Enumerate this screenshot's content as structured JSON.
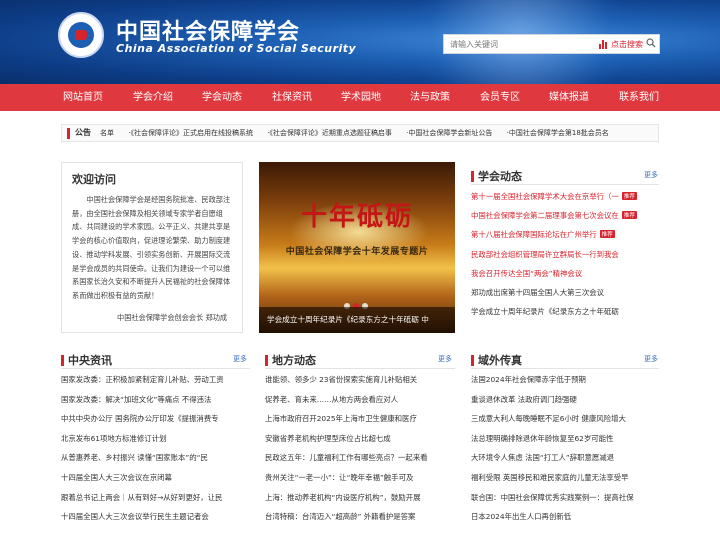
{
  "header": {
    "title": "中国社会保障学会",
    "subtitle": "China Association of Social Security",
    "search": {
      "placeholder": "请输入关键词",
      "button_label": "点击搜索"
    }
  },
  "nav": [
    "网站首页",
    "学会介绍",
    "学会动态",
    "社保资讯",
    "学术园地",
    "法与政策",
    "会员专区",
    "媒体报道",
    "联系我们"
  ],
  "notice": {
    "label": "公告",
    "items": [
      "名单",
      "·《社会保障评论》正式启用在线投稿系统",
      "·《社会保障评论》近期重点选题征稿启事",
      "·中国社会保障学会新址公告",
      "·中国社会保障学会第18批会员名"
    ]
  },
  "welcome": {
    "title": "欢迎访问",
    "body": "中国社会保障学会是经国务院批准、民政部注册，由全国社会保障及相关领域专家学者自愿组成、共同建设的学术家园。公平正义、共建共享是学会的核心价值取向，促进理论繁荣、助力制度建设、推动学科发展、引领实务创新、开展国际交流是学会成员的共同使命。让我们为建设一个可以维系国家长治久安和不断提升人民福祉的社会保障体系而做出积极有益的贡献！",
    "signature": "中国社会保障学会创会会长 郑功成"
  },
  "hero": {
    "calligraphy": "十年砥砺",
    "subline": "中国社会保障学会十年发展专题片",
    "caption": "学会成立十周年纪录片《纪录东方之十年砥砺 中"
  },
  "news": {
    "title": "学会动态",
    "more": "更多",
    "items": [
      {
        "text": "第十一届全国社会保障学术大会在京举行（一",
        "tag": "推荐",
        "style": "red"
      },
      {
        "text": "中国社会保障学会第二届理事会第七次会议在",
        "tag": "推荐",
        "style": "red"
      },
      {
        "text": "第十八届社会保障国际论坛在广州举行",
        "tag": "推荐",
        "style": "red"
      },
      {
        "text": "民政部社会组织管理局许立群局长一行到我会",
        "tag": "",
        "style": "red"
      },
      {
        "text": "我会召开传达全国“两会”精神会议",
        "tag": "",
        "style": "red"
      },
      {
        "text": "郑功成出席第十四届全国人大第三次会议",
        "tag": "",
        "style": "dark"
      },
      {
        "text": "学会成立十周年纪录片《纪录东方之十年砥砺",
        "tag": "",
        "style": "dark"
      }
    ]
  },
  "central": {
    "title": "中央资讯",
    "more": "更多",
    "items": [
      "国家发改委：正积极加紧制定育儿补贴、劳动工资",
      "国家发改委：解决“加班文化”等痛点 不得违法",
      "中共中央办公厅 国务院办公厅印发《提振消费专",
      "北京发布61项地方标准修订计划",
      "从普惠养老、乡村振兴 读懂“国家账本”的“民",
      "十四届全国人大三次会议在京闭幕",
      "跟着总书记上两会｜从有到好→从好到更好，让民",
      "十四届全国人大三次会议举行民生主题记者会"
    ]
  },
  "local": {
    "title": "地方动态",
    "more": "更多",
    "items": [
      "谁能领、领多少 23省份探索实施育儿补贴相关",
      "促养老、育未来……从地方两会看应对人",
      "上海市政府召开2025年上海市卫生健康和医疗",
      "安徽省养老机构护理型床位占比超七成",
      "民政这五年：儿童福利工作有哪些亮点？一起来看",
      "贵州关注“一老一小”：让“晚年幸福”触手可及",
      "上海：推动养老机构“内设医疗机构”，鼓励开展",
      "台湾特稿：台湾迈入“超高龄” 外籍看护是答案"
    ]
  },
  "overseas": {
    "title": "域外传真",
    "more": "更多",
    "items": [
      "法国2024年社会保障赤字低于预期",
      "重谈退休改革 法政府调门趋强硬",
      "三成意大利人每晚睡眠不足6小时 健康风险增大",
      "法总理明确排除退休年龄恢复至62岁可能性",
      "大环境令人焦虑 法国“打工人”辞职意愿减退",
      "福利受限 英国移民和难民家庭的儿童无法享受早",
      "联合国：中国社会保障优秀实践案例一：提高社保",
      "日本2024年出生人口再创新低"
    ]
  }
}
